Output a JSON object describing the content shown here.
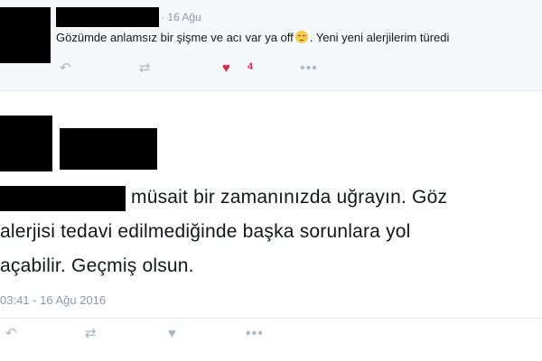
{
  "top_tweet": {
    "date": "· 16 Ağu",
    "text_before_emoji": "Gözümde anlamsız bir şişme ve acı var ya off",
    "emoji": "pensive-face-emoji",
    "text_after_emoji": ". Yeni yeni alerjilerim türedi",
    "like_count": "4",
    "colors": {
      "background": "#f5f8fa",
      "like": "#e2264d",
      "icon": "#aab8c2"
    }
  },
  "reply_tweet": {
    "text_lines": [
      "müsait bir zamanınızda uğrayın. Göz",
      "alerjisi tedavi edilmediğinde başka sorunlara yol",
      "açabilir. Geçmiş olsun."
    ],
    "timestamp": "03:41 - 16 Ağu 2016"
  },
  "icons": {
    "reply": "↶",
    "retweet": "⇄",
    "like": "♥",
    "more": "•••"
  }
}
